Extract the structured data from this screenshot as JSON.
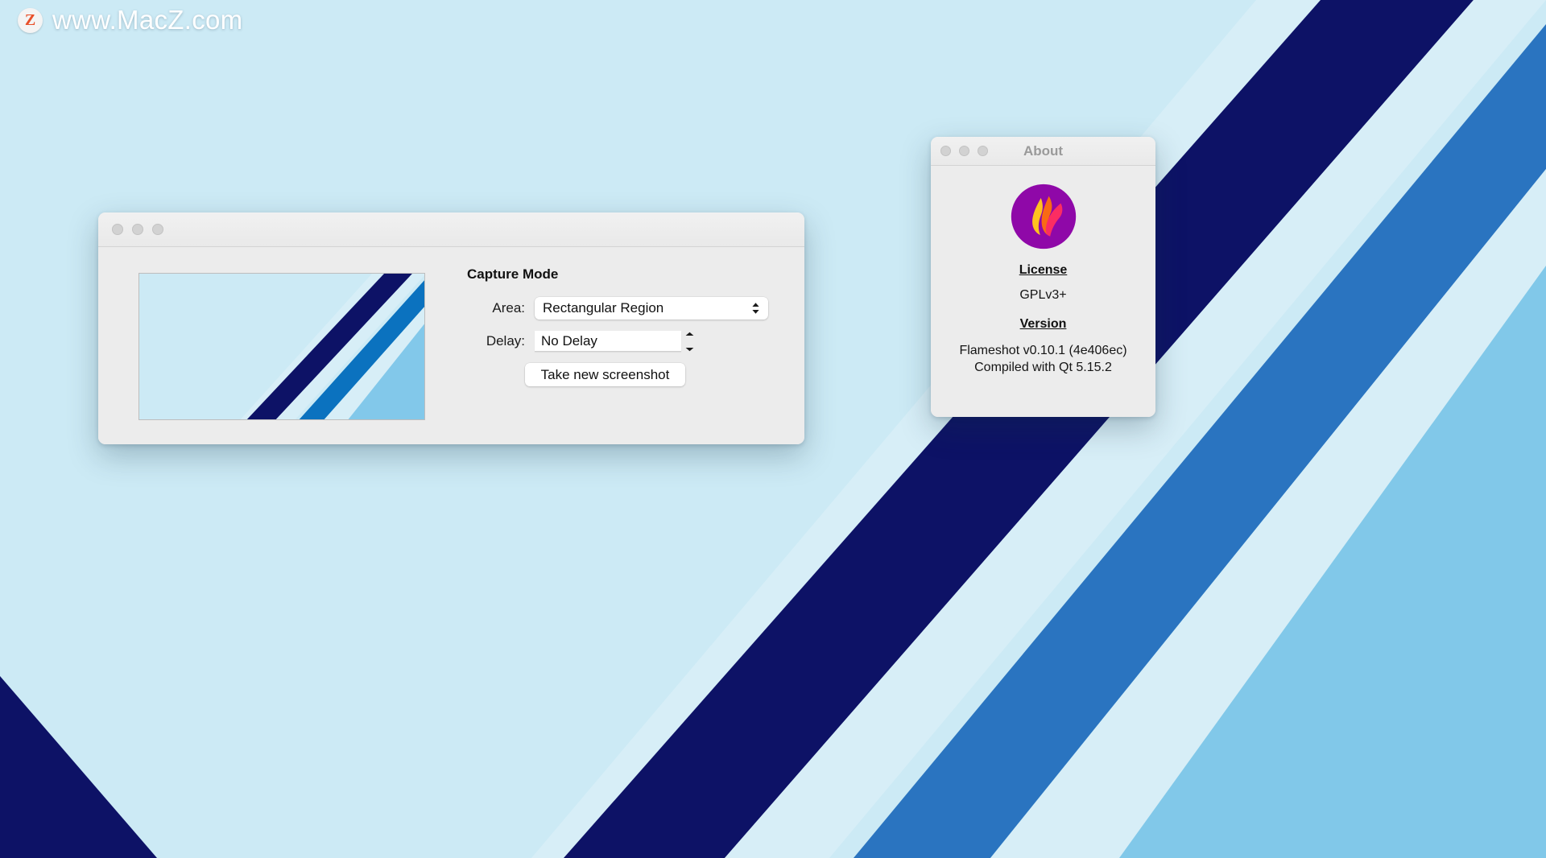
{
  "watermark": {
    "badge_letter": "Z",
    "text": "www.MacZ.com"
  },
  "desktop": {
    "background_color": "#cceaf5",
    "stripe_navy": "#0d1266",
    "stripe_light": "#cceaf5",
    "stripe_pale": "#d7eef7",
    "stripe_blue": "#2a74c0",
    "stripe_steel": "#7fc6e8"
  },
  "main_window": {
    "title": "",
    "traffic_lights": [
      "close-button",
      "minimize-button",
      "maximize-button"
    ],
    "capture_mode_title": "Capture Mode",
    "area": {
      "label": "Area:",
      "value": "Rectangular Region"
    },
    "delay": {
      "label": "Delay:",
      "value": "No Delay"
    },
    "take_screenshot_label": "Take new screenshot"
  },
  "about_window": {
    "title": "About",
    "traffic_lights": [
      "close-button",
      "minimize-button",
      "maximize-button"
    ],
    "logo_name": "flameshot-logo",
    "license_heading": "License",
    "license_value": "GPLv3+",
    "version_heading": "Version",
    "version_line_1": "Flameshot v0.10.1 (4e406ec)",
    "version_line_2": "Compiled with Qt 5.15.2",
    "logo_colors": {
      "circle": "#8f08a8",
      "flame_yellow": "#ffc21f",
      "flame_orange": "#f96a14",
      "flame_red": "#fb2d62"
    }
  }
}
